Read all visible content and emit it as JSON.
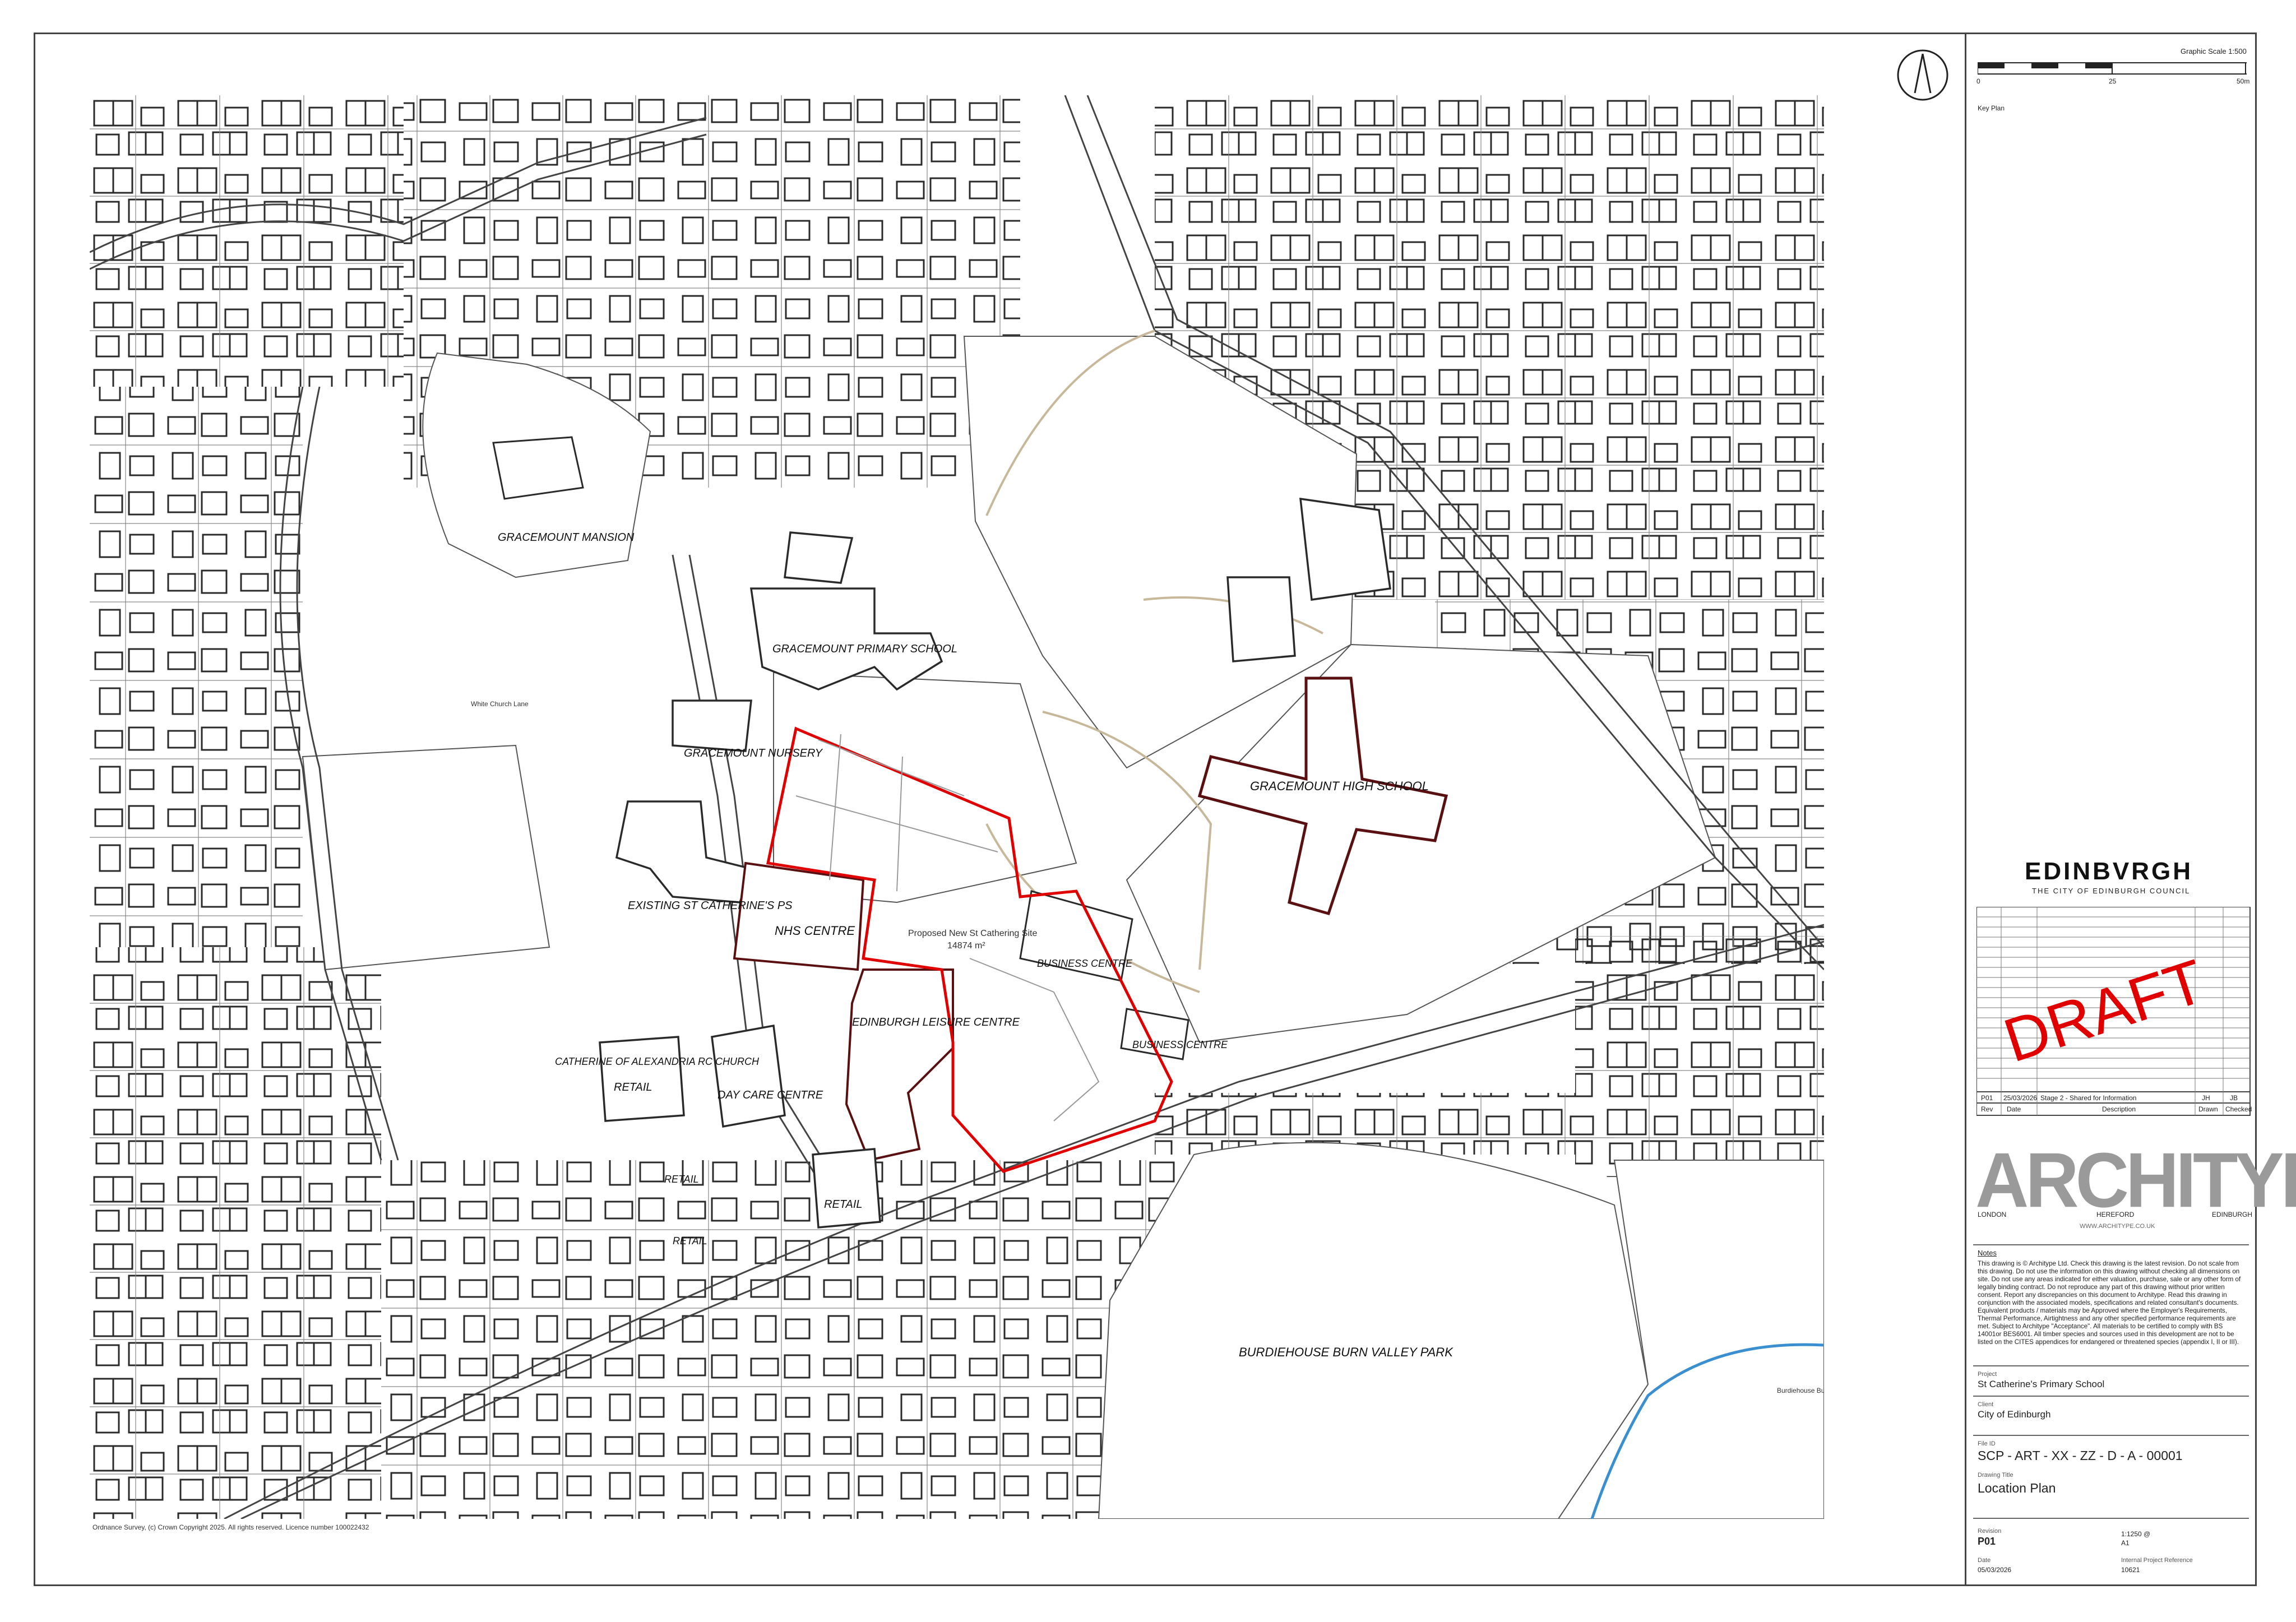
{
  "map": {
    "labels": {
      "gracemount_mansion": "GRACEMOUNT MANSION",
      "gracemount_primary": "GRACEMOUNT PRIMARY SCHOOL",
      "gracemount_nursery": "GRACEMOUNT NURSERY",
      "existing_st_catherines": "EXISTING ST CATHERINE'S PS",
      "nhs_centre": "NHS CENTRE",
      "edinburgh_leisure": "EDINBURGH LEISURE CENTRE",
      "day_care": "DAY CARE CENTRE",
      "retail_1": "RETAIL",
      "retail_2": "RETAIL",
      "retail_3": "RETAIL",
      "retail_4": "RETAIL",
      "church": "CATHERINE OF ALEXANDRIA RC CHURCH",
      "business_centre_1": "BUSINESS CENTRE",
      "business_centre_2": "BUSINESS CENTRE",
      "gracemount_high": "GRACEMOUNT HIGH SCHOOL",
      "burdiehouse_park": "BURDIEHOUSE BURN VALLEY PARK",
      "site_name": "Proposed New St Cathering Site",
      "site_area": "14874 m²",
      "white_church_lane": "White Church Lane",
      "burdiehouse_burn": "Burdiehouse Burn",
      "copyright": "Ordnance Survey, (c) Crown Copyright 2025. All rights reserved. Licence number 100022432"
    },
    "colors": {
      "site_boundary": "#e00000",
      "buildings_edge": "#5a1010",
      "linework": "#555555",
      "burn": "#3a8fd0",
      "paths": "#c8b89a"
    }
  },
  "scale": {
    "title": "Graphic Scale 1:500",
    "ticks": [
      "0",
      "25",
      "50m"
    ]
  },
  "key_plan": "Key Plan",
  "client_logo": {
    "wordmark": "EDINBVRGH",
    "subtitle": "THE CITY OF EDINBURGH COUNCIL"
  },
  "stamp": "DRAFT",
  "revisions": {
    "headers": [
      "Rev",
      "Date",
      "Description",
      "Drawn",
      "Checked"
    ],
    "rows": [
      [
        "P01",
        "25/03/2026",
        "Stage 2 - Shared for Information",
        "JH",
        "JB"
      ]
    ]
  },
  "architect": {
    "logo": "ARCHITYPE",
    "cities": [
      "LONDON",
      "HEREFORD",
      "EDINBURGH"
    ],
    "url": "WWW.ARCHITYPE.CO.UK"
  },
  "notes": {
    "title": "Notes",
    "body": "This drawing is © Architype Ltd. Check this drawing is the latest revision. Do not scale from this drawing. Do not use the information on this drawing without checking all dimensions on site. Do not use any areas indicated for either valuation, purchase, sale or any other form of legally binding contract. Do not reproduce any part of this drawing without prior written consent. Report any discrepancies on this document to Architype. Read this drawing in conjunction with the associated models, specifications and related consultant's documents. Equivalent products / materials may be Approved where the Employer's Requirements, Thermal Performance, Airtightness and any other specified performance requirements are met. Subject to Architype \"Acceptance\". All materials to be certified to comply with BS 14001or BES6001. All timber species and sources used in this development are not to be listed on the CITES appendices for endangered or threatened species (appendix I, II or III)."
  },
  "title_block": {
    "project_caption": "Project",
    "project": "St Catherine's Primary School",
    "client_caption": "Client",
    "client": "City of Edinburgh",
    "file_caption": "File ID",
    "file_id": "SCP - ART - XX - ZZ - D - A - 00001",
    "title_caption": "Drawing Title",
    "title": "Location Plan",
    "revision_caption": "Revision",
    "revision": "P01",
    "scale_value": "1:1250 @",
    "sheet_size": "A1",
    "date_caption": "Date",
    "date": "05/03/2026",
    "ref_caption": "Internal Project Reference",
    "ref": "10621"
  }
}
